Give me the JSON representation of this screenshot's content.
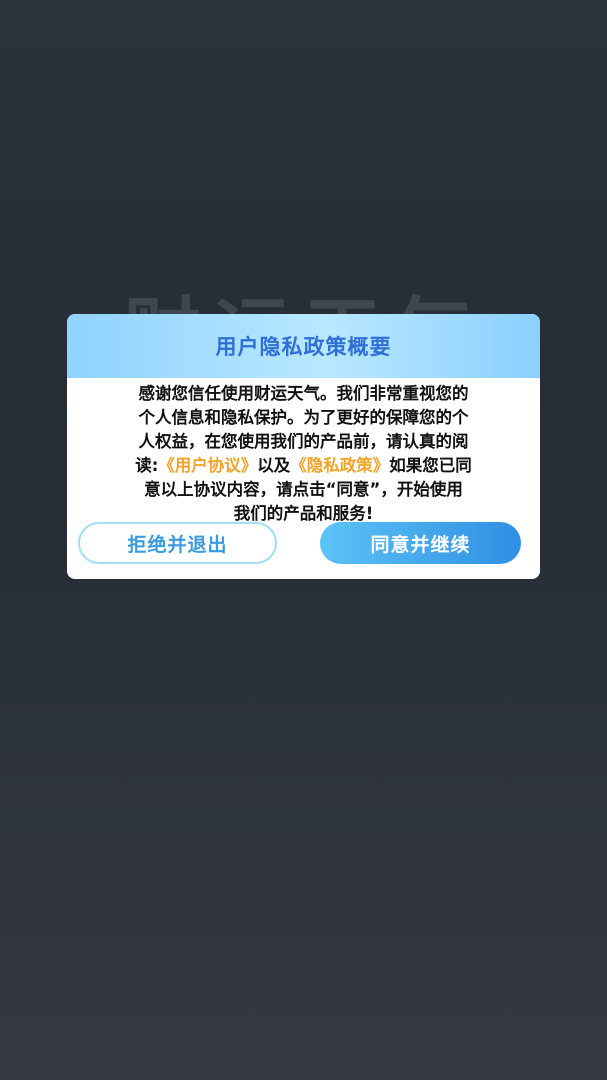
{
  "background": {
    "title_text": "财运天气"
  },
  "dialog": {
    "title": "用户隐私政策概要",
    "body": {
      "line1": "感谢您信任使用财运天气。我们非常重视您的",
      "line2": "个人信息和隐私保护。为了更好的保障您的个",
      "line3": "人权益，在您使用我们的产品前，请认真的阅",
      "line4_prefix": "读:",
      "user_agreement_link": "《用户协议》",
      "line4_middle": "以及",
      "privacy_policy_link": "《隐私政策》",
      "line4_suffix": "如果您已同",
      "line5": "意以上协议内容，请点击“同意”，开始使用",
      "line6": "我们的产品和服务!"
    },
    "decline_label": "拒绝并退出",
    "accept_label": "同意并继续"
  },
  "colors": {
    "header_gradient": "#9fdcff",
    "title": "#2f6fd6",
    "link": "#f0a52a",
    "accept_button": "#3ea7ec",
    "decline_border": "#9fdff6"
  }
}
